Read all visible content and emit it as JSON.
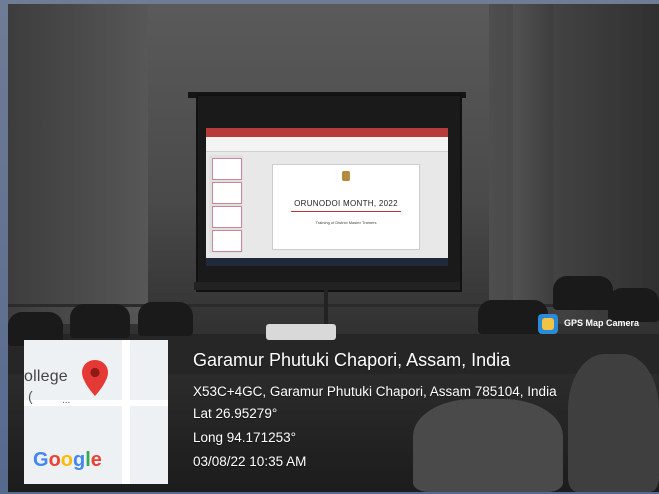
{
  "photo": {
    "projected_slide": {
      "title": "ORUNODOI MONTH, 2022",
      "subtitle": "Training of District Master Trainers"
    }
  },
  "overlay": {
    "app_badge": "GPS Map Camera",
    "location_title": "Garamur Phutuki Chapori, Assam, India",
    "address": "X53C+4GC, Garamur Phutuki Chapori, Assam 785104, India",
    "latitude": "Lat 26.95279°",
    "longitude": "Long 94.171253°",
    "datetime": "03/08/22 10:35 AM"
  },
  "map": {
    "place_fragment": "ollege",
    "paren": "(",
    "dots": "...",
    "brand": "Google",
    "pin_color": "#e53935"
  }
}
